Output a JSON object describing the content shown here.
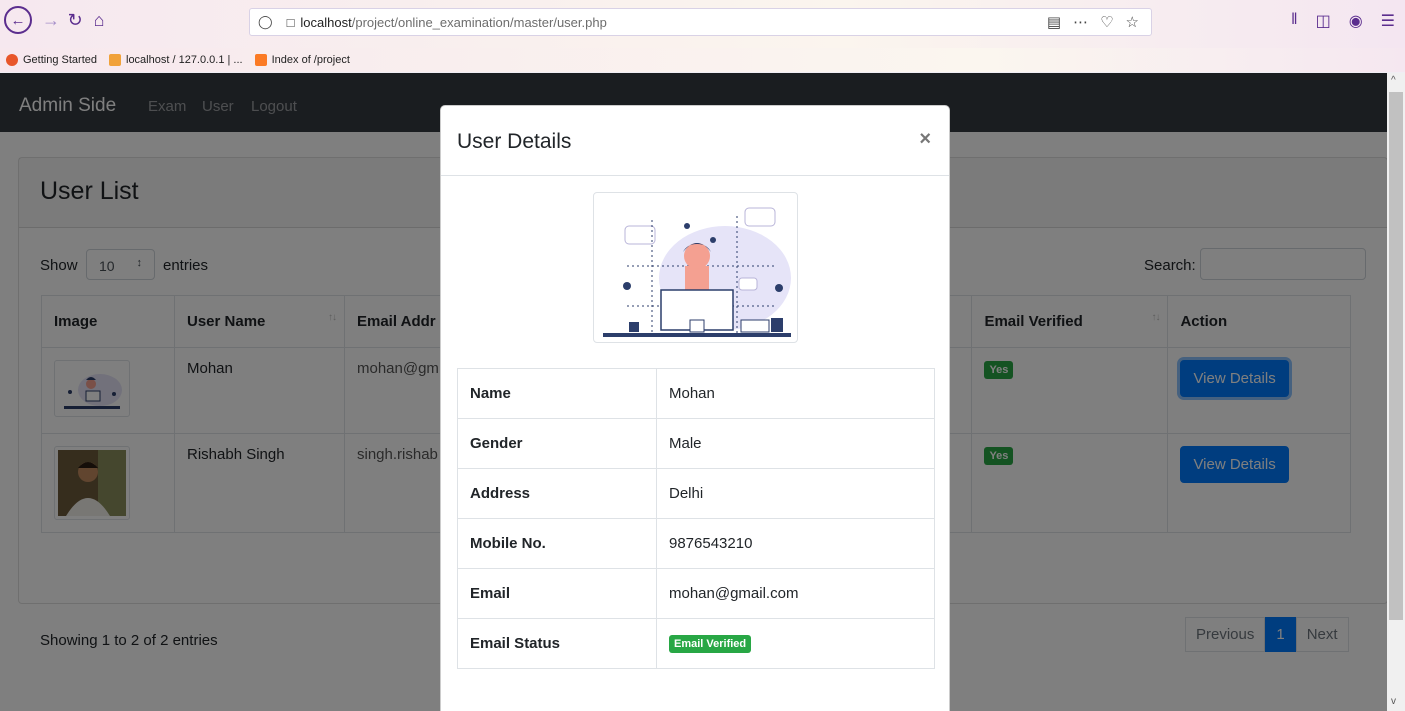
{
  "browser": {
    "url_host": "localhost",
    "url_path": "/project/online_examination/master/user.php",
    "bookmarks": [
      "Getting Started",
      "localhost / 127.0.0.1 | ...",
      "Index of /project"
    ]
  },
  "navbar": {
    "brand": "Admin Side",
    "links": [
      "Exam",
      "User",
      "Logout"
    ]
  },
  "card": {
    "title": "User List",
    "show_label": "Show",
    "entries_value": "10",
    "entries_label": "entries",
    "search_label": "Search:",
    "info": "Showing 1 to 2 of 2 entries",
    "pagination": {
      "previous": "Previous",
      "current": "1",
      "next": "Next"
    }
  },
  "table": {
    "headers": [
      "Image",
      "User Name",
      "Email Addr",
      "Email Verified",
      "Action"
    ],
    "rows": [
      {
        "name": "Mohan",
        "email": "mohan@gm",
        "verified": "Yes",
        "action": "View Details"
      },
      {
        "name": "Rishabh Singh",
        "email": "singh.rishab",
        "verified": "Yes",
        "action": "View Details"
      }
    ]
  },
  "modal": {
    "title": "User Details",
    "close": "×",
    "details": [
      {
        "key": "Name",
        "value": "Mohan"
      },
      {
        "key": "Gender",
        "value": "Male"
      },
      {
        "key": "Address",
        "value": "Delhi"
      },
      {
        "key": "Mobile No.",
        "value": "9876543210"
      },
      {
        "key": "Email",
        "value": "mohan@gmail.com"
      },
      {
        "key": "Email Status",
        "badge": "Email Verified"
      }
    ]
  },
  "colors": {
    "primary": "#007bff",
    "success": "#28a745",
    "navbar": "#343a40"
  }
}
